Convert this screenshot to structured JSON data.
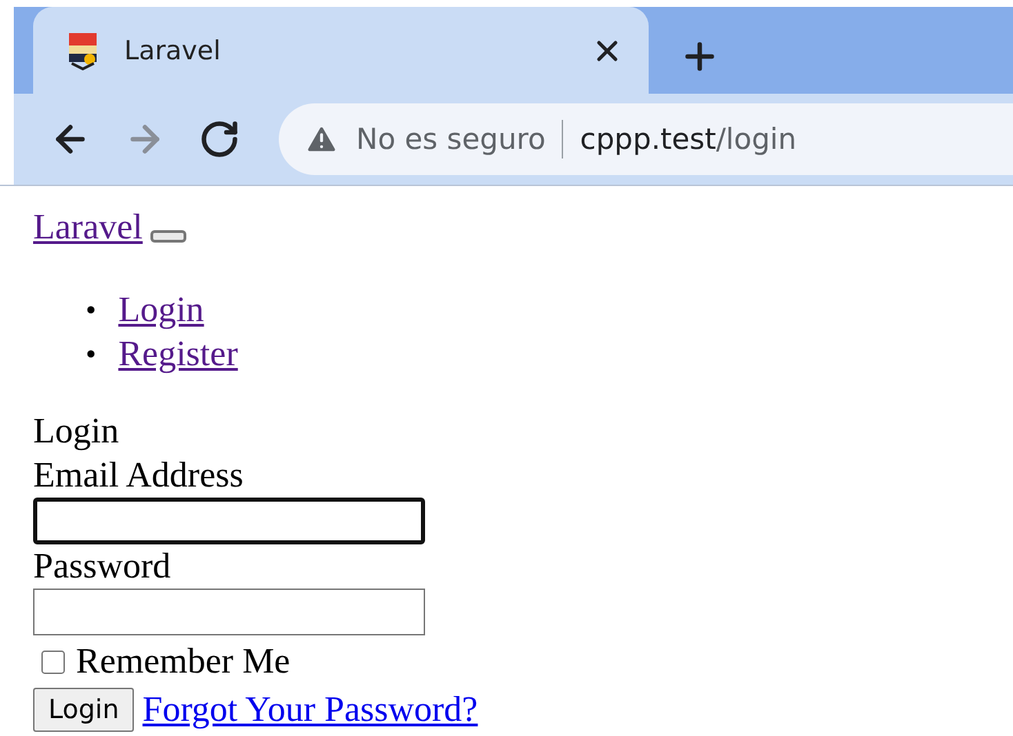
{
  "browser": {
    "tab": {
      "title": "Laravel",
      "selected": true
    },
    "nav_buttons": [
      {
        "kind": "back",
        "disabled": false
      },
      {
        "kind": "forward",
        "disabled": true
      },
      {
        "kind": "reload",
        "disabled": false
      }
    ],
    "address": {
      "security": "No es seguro",
      "host": "cppp.test",
      "path": "/login"
    }
  },
  "navbar": {
    "brand": {
      "label": "Laravel",
      "visited": true
    },
    "links": [
      {
        "marker": "•",
        "label": "Login",
        "visited": true
      },
      {
        "marker": "•",
        "label": "Register",
        "visited": true
      }
    ]
  },
  "form": {
    "heading": "Login",
    "fields": [
      {
        "label": "Email Address",
        "focused": true
      },
      {
        "label": "Password",
        "focused": false
      }
    ],
    "remember": {
      "label": "Remember Me",
      "checked": false
    },
    "submit": "Login",
    "forgot": {
      "label": "Forgot Your Password?",
      "visited": false
    }
  }
}
